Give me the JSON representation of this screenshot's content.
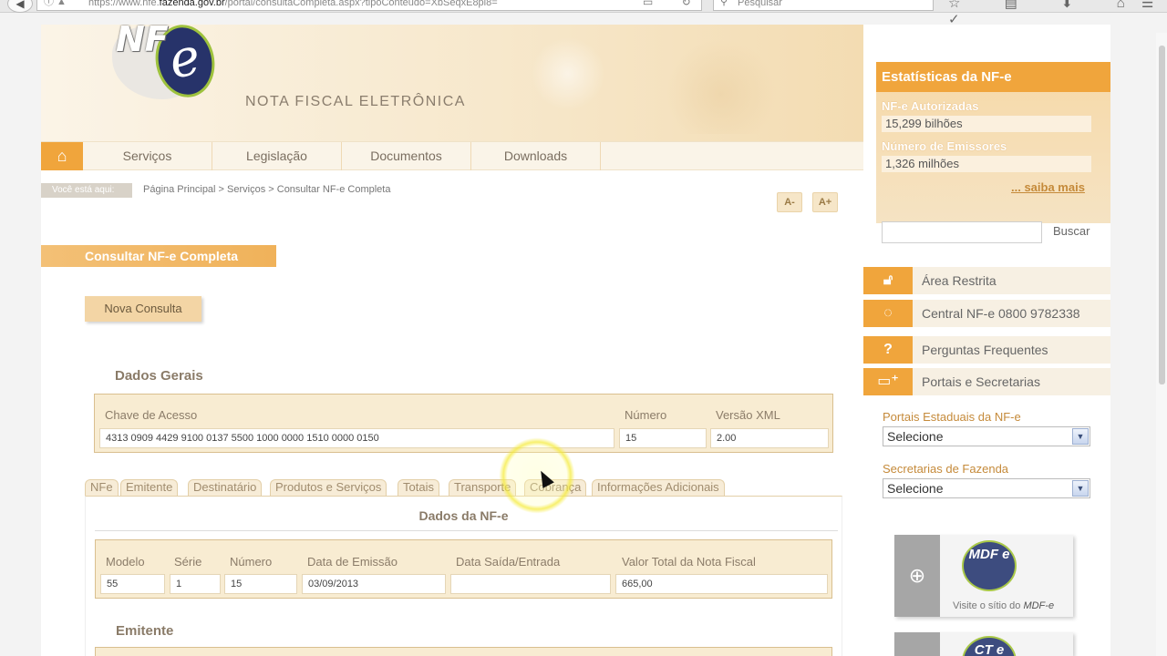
{
  "browser": {
    "url_prefix": "https://www.nfe.",
    "url_domain": "fazenda.gov.br",
    "url_suffix": "/portal/consultaCompleta.aspx?tipoConteudo=XbSeqxE8pl8=",
    "search_placeholder": "Pesquisar"
  },
  "header": {
    "logo_text_nf": "NF",
    "logo_text_e": "e",
    "title": "NOTA FISCAL ELETRÔNICA"
  },
  "nav": {
    "items": [
      "Serviços",
      "Legislação",
      "Documentos",
      "Downloads"
    ]
  },
  "breadcrumb": {
    "label": "Você está aqui:",
    "path": "Página Principal > Serviços > Consultar NF-e Completa"
  },
  "font_controls": {
    "decrease": "A-",
    "increase": "A+"
  },
  "page_title": "Consultar NF-e Completa",
  "new_query_button": "Nova Consulta",
  "dados_gerais": {
    "heading": "Dados Gerais",
    "labels": {
      "chave": "Chave de Acesso",
      "numero": "Número",
      "versao": "Versão XML"
    },
    "values": {
      "chave": "4313 0909 4429 9100 0137 5500 1000 0000 1510 0000 0150",
      "numero": "15",
      "versao": "2.00"
    }
  },
  "tabs": [
    "NFe",
    "Emitente",
    "Destinatário",
    "Produtos e Serviços",
    "Totais",
    "Transporte",
    "Cobrança",
    "Informações Adicionais"
  ],
  "dados_nfe": {
    "heading": "Dados da NF-e",
    "labels": {
      "modelo": "Modelo",
      "serie": "Série",
      "numero": "Número",
      "emissao": "Data de Emissão",
      "saida": "Data Saída/Entrada",
      "valor": "Valor Total da Nota Fiscal"
    },
    "values": {
      "modelo": "55",
      "serie": "1",
      "numero": "15",
      "emissao": "03/09/2013",
      "saida": "",
      "valor": "665,00"
    }
  },
  "emitente_heading": "Emitente",
  "sidebar": {
    "stats_title": "Estatísticas da NF-e",
    "autorizadas_label": "NF-e Autorizadas",
    "autorizadas_value": "15,299 bilhões",
    "emissores_label": "Número de Emissores",
    "emissores_value": "1,326 milhões",
    "saiba_mais": "... saiba mais",
    "search_button": "Buscar",
    "links": [
      "Área Restrita",
      "Central NF-e 0800 9782338",
      "Perguntas Frequentes",
      "Portais e Secretarias"
    ],
    "portais_label": "Portais Estaduais da NF-e",
    "portais_value": "Selecione",
    "secretarias_label": "Secretarias de Fazenda",
    "secretarias_value": "Selecione",
    "mdfe_logo": "MDF e",
    "mdfe_text_prefix": "Visite o sítio do ",
    "mdfe_text_name": "MDF-e",
    "cte_logo": "CT e"
  }
}
